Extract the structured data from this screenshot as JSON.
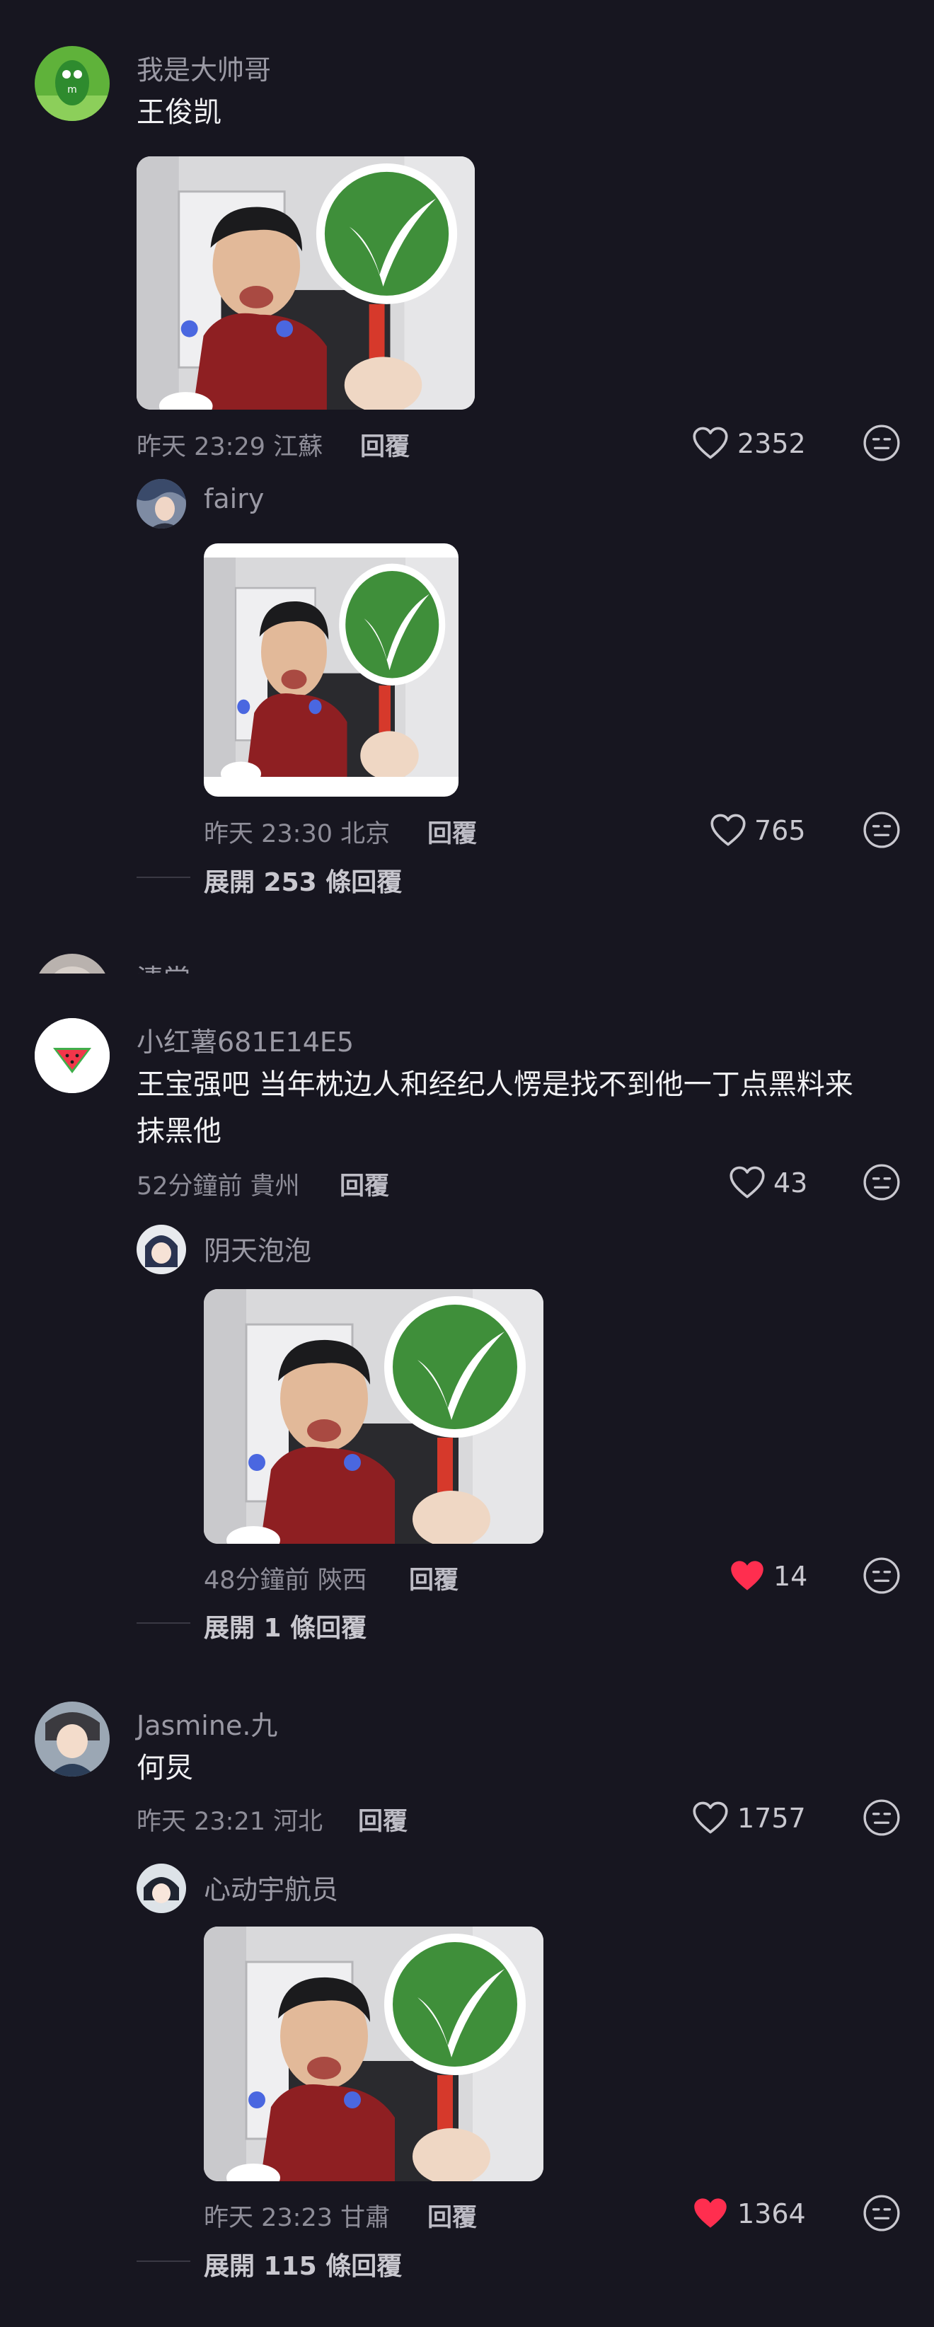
{
  "comments": [
    {
      "username": "我是大帅哥",
      "text": "王俊凯",
      "meta": "昨天 23:29 江蘇",
      "reply_label": "回覆",
      "likes": "2352",
      "liked": false,
      "reply": {
        "username": "fairy",
        "meta": "昨天 23:30 北京",
        "reply_label": "回覆",
        "likes": "765",
        "liked": false
      },
      "expand_label": "展開 253 條回覆"
    },
    {
      "username": "清當",
      "partial": true
    },
    {
      "username": "小红薯681E14E5",
      "text_line1": "王宝强吧 当年枕边人和经纪人愣是找不到他一丁点黑料来",
      "text_line2": "抹黑他",
      "meta": "52分鐘前 貴州",
      "reply_label": "回覆",
      "likes": "43",
      "liked": false,
      "reply": {
        "username": "阴天泡泡",
        "meta": "48分鐘前 陝西",
        "reply_label": "回覆",
        "likes": "14",
        "liked": true
      },
      "expand_label": "展開 1 條回覆"
    },
    {
      "username": "Jasmine.九",
      "text": "何炅",
      "meta": "昨天 23:21 河北",
      "reply_label": "回覆",
      "likes": "1757",
      "liked": false,
      "reply": {
        "username": "心动宇航员",
        "meta": "昨天 23:23 甘肅",
        "reply_label": "回覆",
        "likes": "1364",
        "liked": true
      },
      "expand_label": "展開 115 條回覆"
    }
  ],
  "icons": {
    "like": "heart-outline-icon",
    "liked": "heart-filled-icon",
    "dislike": "neutral-face-icon"
  },
  "colors": {
    "background": "#171620",
    "liked_red": "#FF2E4F",
    "check_green": "#3F8F3A"
  }
}
